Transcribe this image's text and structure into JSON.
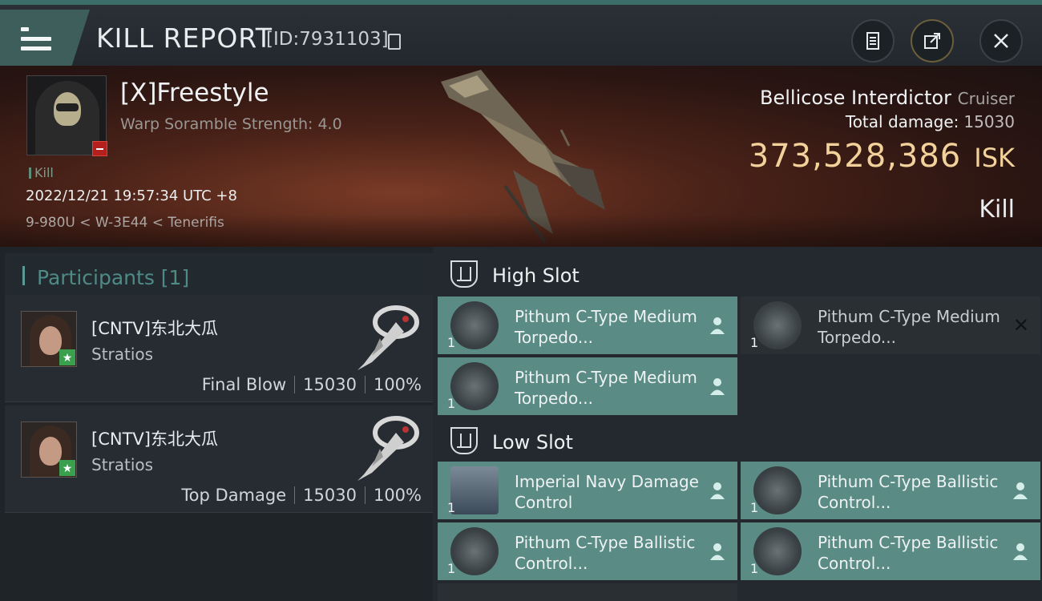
{
  "header": {
    "title": "KILL REPORT",
    "report_id": "[ID:7931103]",
    "icons": [
      "menu-icon",
      "copy-icon",
      "clipboard-icon",
      "share-icon",
      "close-icon"
    ]
  },
  "victim": {
    "name": "[X]Freestyle",
    "subtitle": "Warp Soramble Strength: 4.0",
    "tag": "Kill",
    "datetime": "2022/12/21 19:57:34 UTC +8",
    "location": "9-980U < W-3E44 < Tenerifis",
    "ship_name": "Bellicose Interdictor",
    "ship_class": "Cruiser",
    "damage_label": "Total damage:",
    "damage_value": "15030",
    "isk_value": "373,528,386",
    "isk_unit": "ISK",
    "kill_label": "Kill"
  },
  "participants": {
    "title": "Participants [1]",
    "items": [
      {
        "name": "[CNTV]东北大瓜",
        "ship": "Stratios",
        "role": "Final Blow",
        "damage": "15030",
        "percent": "100%"
      },
      {
        "name": "[CNTV]东北大瓜",
        "ship": "Stratios",
        "role": "Top Damage",
        "damage": "15030",
        "percent": "100%"
      }
    ]
  },
  "fitting": {
    "high_slot": {
      "title": "High Slot",
      "modules": [
        {
          "name": "Pithum C-Type Medium Torpedo...",
          "qty": "1",
          "state": "dropped"
        },
        {
          "name": "Pithum C-Type Medium Torpedo...",
          "qty": "1",
          "state": "destroyed"
        },
        {
          "name": "Pithum C-Type Medium Torpedo...",
          "qty": "1",
          "state": "dropped"
        }
      ]
    },
    "low_slot": {
      "title": "Low Slot",
      "modules": [
        {
          "name": "Imperial Navy Damage Control",
          "qty": "1",
          "state": "dropped"
        },
        {
          "name": "Pithum C-Type Ballistic Control...",
          "qty": "1",
          "state": "dropped"
        },
        {
          "name": "Pithum C-Type Ballistic Control...",
          "qty": "1",
          "state": "dropped"
        },
        {
          "name": "Pithum C-Type Ballistic Control...",
          "qty": "1",
          "state": "dropped"
        }
      ]
    }
  },
  "colors": {
    "accent": "#5a8c85",
    "isk": "#f2d29a",
    "star_badge": "#3aa04e",
    "minus_badge": "#b4201e"
  }
}
